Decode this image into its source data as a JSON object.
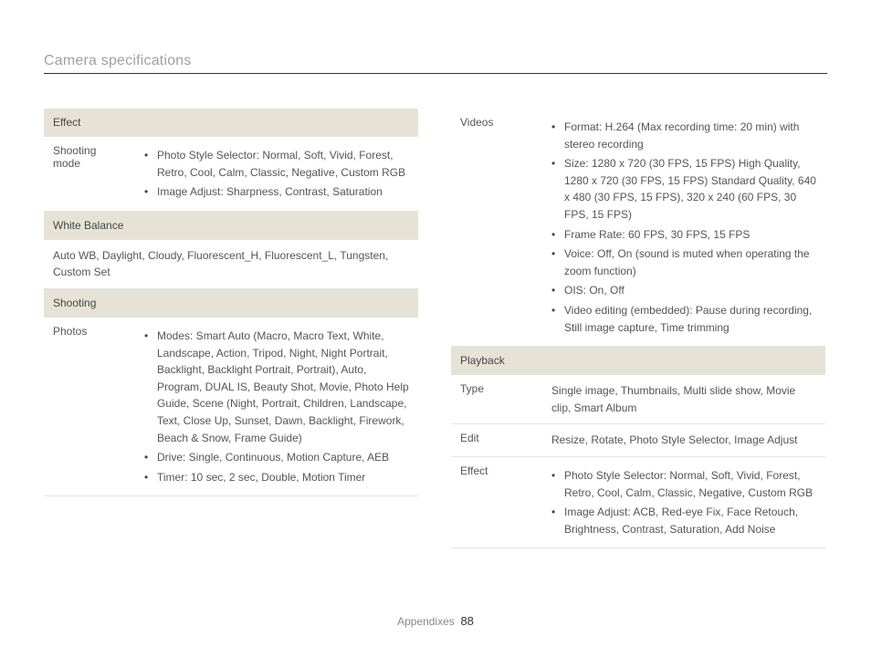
{
  "page": {
    "title": "Camera specifications"
  },
  "left": {
    "effect": {
      "header": "Effect",
      "rows": [
        {
          "label": "Shooting mode",
          "bullets": [
            "Photo Style Selector: Normal, Soft, Vivid, Forest, Retro, Cool, Calm, Classic, Negative, Custom RGB",
            "Image Adjust: Sharpness, Contrast, Saturation"
          ]
        }
      ]
    },
    "white_balance": {
      "header": "White Balance",
      "text": "Auto WB, Daylight, Cloudy, Fluorescent_H, Fluorescent_L, Tungsten, Custom Set"
    },
    "shooting": {
      "header": "Shooting",
      "rows": [
        {
          "label": "Photos",
          "bullets": [
            "Modes: Smart Auto (Macro, Macro Text, White, Landscape, Action, Tripod, Night, Night Portrait, Backlight, Backlight Portrait, Portrait), Auto, Program, DUAL IS, Beauty Shot, Movie, Photo Help Guide, Scene (Night, Portrait, Children, Landscape, Text, Close Up, Sunset, Dawn, Backlight, Firework, Beach & Snow, Frame Guide)",
            "Drive: Single, Continuous, Motion Capture, AEB",
            "Timer: 10 sec, 2 sec, Double, Motion Timer"
          ]
        }
      ]
    }
  },
  "right": {
    "shooting_cont": {
      "rows": [
        {
          "label": "Videos",
          "bullets": [
            "Format: H.264 (Max recording time: 20 min) with stereo recording",
            "Size: 1280 x 720 (30 FPS, 15 FPS) High Quality, 1280 x 720 (30 FPS, 15 FPS) Standard Quality, 640 x 480 (30 FPS, 15 FPS), 320 x 240 (60 FPS, 30 FPS, 15 FPS)",
            "Frame Rate: 60 FPS, 30 FPS, 15 FPS",
            "Voice: Off, On (sound is muted when operating the zoom function)",
            "OIS: On, Off",
            "Video editing (embedded): Pause during recording, Still image capture, Time trimming"
          ]
        }
      ]
    },
    "playback": {
      "header": "Playback",
      "rows": [
        {
          "label": "Type",
          "text": "Single image, Thumbnails, Multi slide show, Movie clip, Smart Album"
        },
        {
          "label": "Edit",
          "text": "Resize, Rotate, Photo Style Selector, Image Adjust"
        },
        {
          "label": "Effect",
          "bullets": [
            "Photo Style Selector: Normal, Soft, Vivid, Forest, Retro, Cool, Calm, Classic, Negative, Custom RGB",
            "Image Adjust: ACB, Red-eye Fix, Face Retouch, Brightness, Contrast, Saturation, Add Noise"
          ]
        }
      ]
    }
  },
  "footer": {
    "section": "Appendixes",
    "page": "88"
  }
}
